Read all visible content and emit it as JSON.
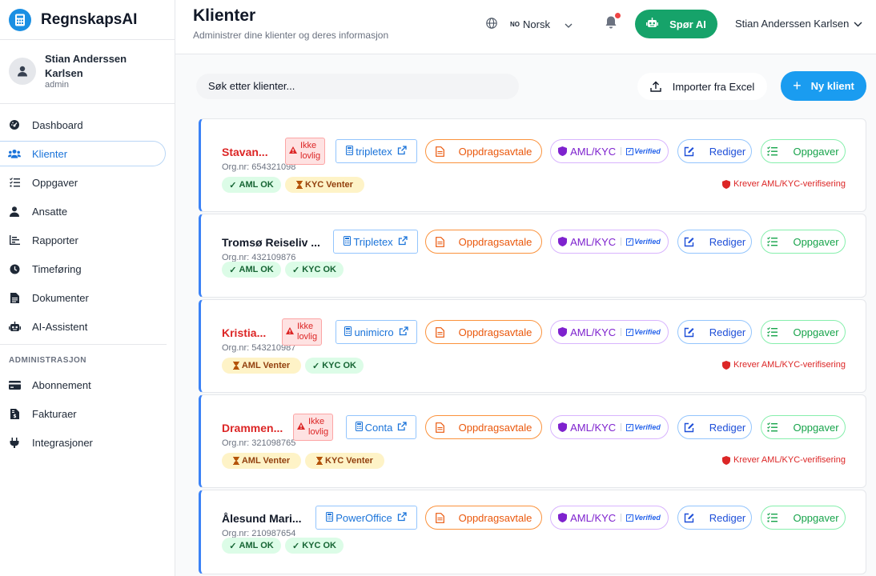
{
  "app": {
    "name": "RegnskapsAI"
  },
  "user": {
    "name": "Stian Anderssen Karlsen",
    "role": "admin"
  },
  "nav": {
    "items": [
      {
        "label": "Dashboard",
        "icon": "dashboard-icon"
      },
      {
        "label": "Klienter",
        "icon": "users-icon",
        "active": true
      },
      {
        "label": "Oppgaver",
        "icon": "tasks-icon"
      },
      {
        "label": "Ansatte",
        "icon": "user-icon"
      },
      {
        "label": "Rapporter",
        "icon": "chart-icon"
      },
      {
        "label": "Timeføring",
        "icon": "clock-icon"
      },
      {
        "label": "Dokumenter",
        "icon": "document-icon"
      },
      {
        "label": "AI-Assistent",
        "icon": "robot-icon"
      }
    ],
    "admin_section": "ADMINISTRASJON",
    "admin_items": [
      {
        "label": "Abonnement",
        "icon": "credit-card-icon"
      },
      {
        "label": "Fakturaer",
        "icon": "invoice-icon"
      },
      {
        "label": "Integrasjoner",
        "icon": "plug-icon"
      }
    ]
  },
  "header": {
    "title": "Klienter",
    "subtitle": "Administrer dine klienter og deres informasjon",
    "language_code": "NO",
    "language": "Norsk",
    "ai_button": "Spør AI",
    "user_name": "Stian Anderssen Karlsen"
  },
  "toolbar": {
    "search_placeholder": "Søk etter klienter...",
    "import_label": "Importer fra Excel",
    "new_label": "Ny klient"
  },
  "actions": {
    "agreement": "Oppdragsavtale",
    "aml": "AML/KYC",
    "verified": "Verified",
    "edit": "Rediger",
    "tasks": "Oppgaver"
  },
  "clients": [
    {
      "name": "Stavan...",
      "warning_flag": true,
      "ikke": [
        "Ikke",
        "lovlig"
      ],
      "org": "Org.nr: 654321098",
      "system": "tripletex",
      "aml": "AML OK",
      "aml_ok": true,
      "kyc": "KYC Venter",
      "kyc_ok": false,
      "notice": "Krever AML/KYC-verifisering"
    },
    {
      "name": "Tromsø Reiseliv ...",
      "warning_flag": false,
      "org": "Org.nr: 432109876",
      "system": "Tripletex",
      "aml": "AML OK",
      "aml_ok": true,
      "kyc": "KYC OK",
      "kyc_ok": true,
      "notice": ""
    },
    {
      "name": "Kristia...",
      "warning_flag": true,
      "ikke": [
        "Ikke",
        "lovlig"
      ],
      "org": "Org.nr: 543210987",
      "system": "unimicro",
      "aml": "AML Venter",
      "aml_ok": false,
      "kyc": "KYC OK",
      "kyc_ok": true,
      "notice": "Krever AML/KYC-verifisering"
    },
    {
      "name": "Drammen...",
      "warning_flag": true,
      "ikke": [
        "Ikke",
        "lovlig"
      ],
      "org": "Org.nr: 321098765",
      "system": "Conta",
      "aml": "AML Venter",
      "aml_ok": false,
      "kyc": "KYC Venter",
      "kyc_ok": false,
      "notice": "Krever AML/KYC-verifisering"
    },
    {
      "name": "Ålesund Mari...",
      "warning_flag": false,
      "org": "Org.nr: 210987654",
      "system": "PowerOffice",
      "aml": "AML OK",
      "aml_ok": true,
      "kyc": "KYC OK",
      "kyc_ok": true,
      "notice": ""
    }
  ]
}
